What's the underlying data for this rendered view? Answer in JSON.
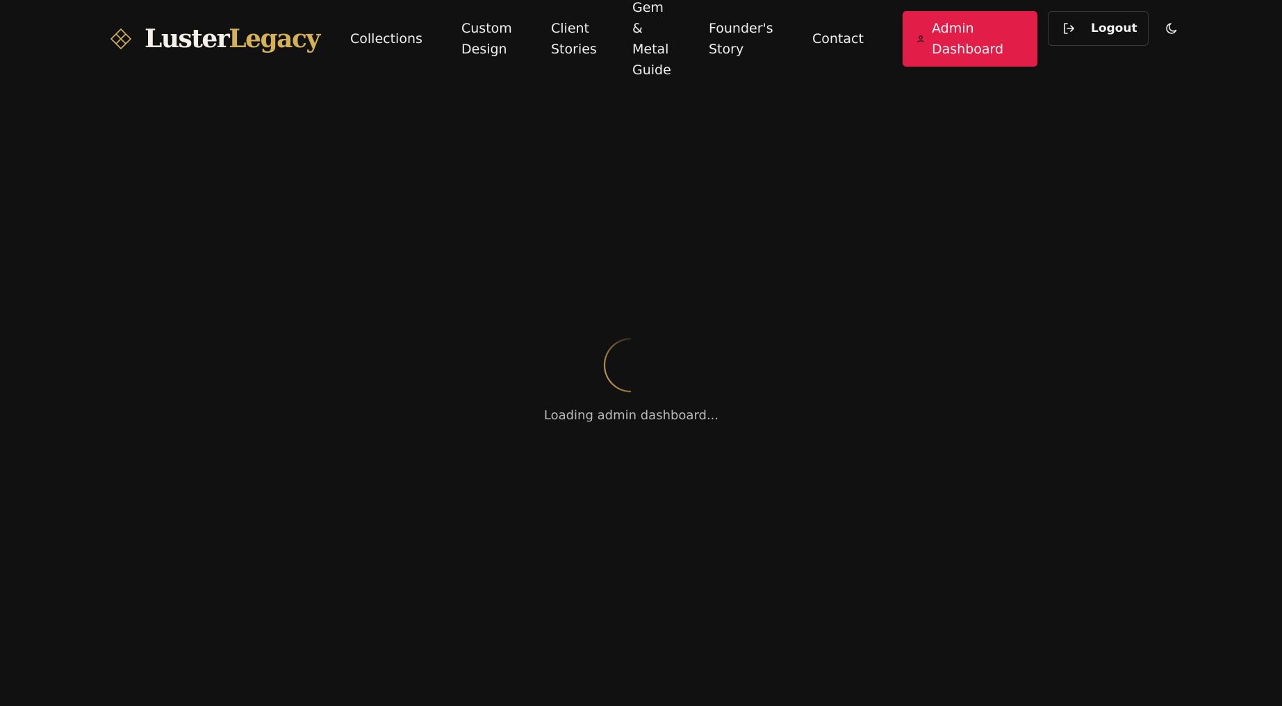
{
  "brand": {
    "name_part1": "Luster",
    "name_part2": "Legacy",
    "icon": "diamond-grid-icon"
  },
  "nav": {
    "collections": [
      "Collections"
    ],
    "custom_design": [
      "Custom",
      "Design"
    ],
    "client_stories": [
      "Client",
      "Stories"
    ],
    "gem_guide": [
      "Gem",
      "&",
      "Metal",
      "Guide"
    ],
    "founders_story": [
      "Founder's",
      "Story"
    ],
    "contact": [
      "Contact"
    ]
  },
  "actions": {
    "admin_dashboard_lines": [
      "Admin",
      "Dashboard"
    ],
    "admin_icon": "user-icon",
    "logout_label": "Logout",
    "logout_icon": "logout-icon",
    "theme_icon": "moon-icon"
  },
  "main": {
    "loading_text": "Loading admin dashboard...",
    "spinner_icon": "spinner-icon"
  },
  "colors": {
    "background": "#111111",
    "accent_gold": "#d4b157",
    "admin_button": "#e11d48",
    "text": "#f0f0f0",
    "muted_text": "#b8b8b8"
  }
}
